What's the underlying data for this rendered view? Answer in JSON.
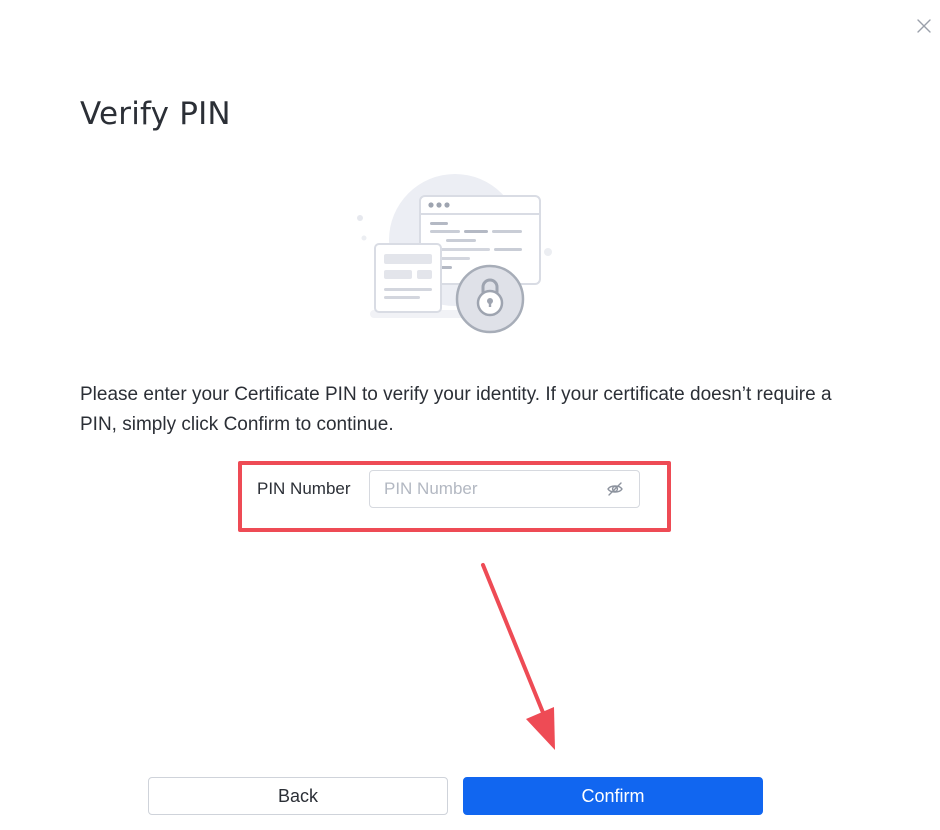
{
  "dialog": {
    "title": "Verify PIN",
    "description": "Please enter your Certificate PIN to verify your identity. If your certificate doesn’t require a PIN, simply click Confirm to continue."
  },
  "pin": {
    "label": "PIN Number",
    "placeholder": "PIN Number",
    "value": ""
  },
  "buttons": {
    "back": "Back",
    "confirm": "Confirm"
  },
  "icons": {
    "close": "close-icon",
    "visibility": "eye-off-icon",
    "illustration": "certificate-lock-illustration"
  },
  "colors": {
    "accent": "#1166f0",
    "annotation": "#ee4b55"
  }
}
